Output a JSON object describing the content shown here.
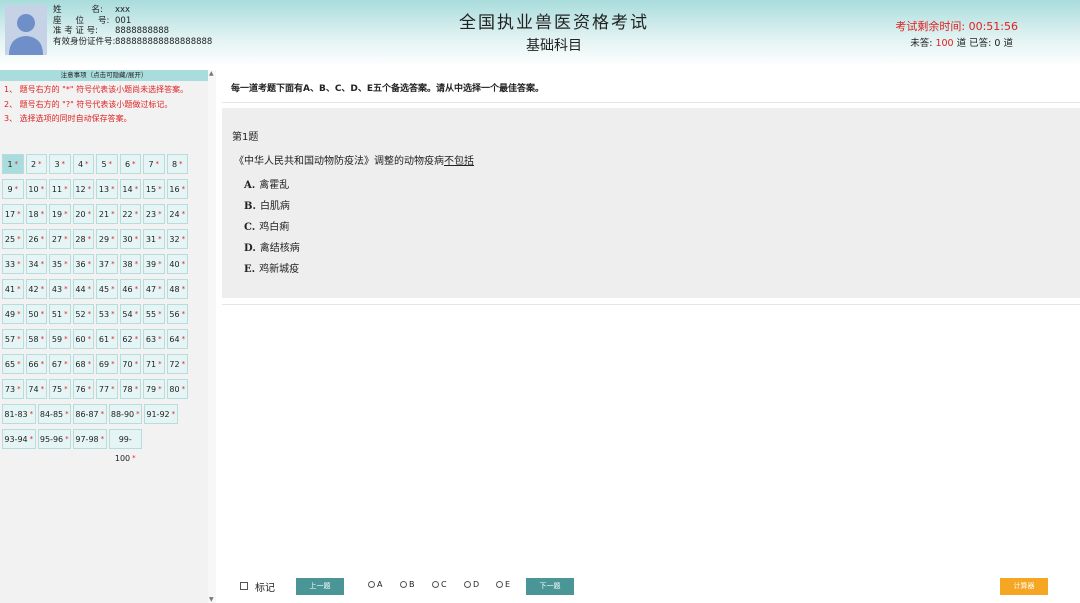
{
  "header": {
    "title": "全国执业兽医资格考试",
    "subtitle": "基础科目",
    "timer_label": "考试剩余时间: 00:51:56",
    "counts_prefix": "未答:",
    "unanswered": "100",
    "counts_mid": "道 已答:",
    "answered": "0",
    "counts_suffix": "道"
  },
  "candidate": {
    "name_label_a": "姓",
    "name_label_b": "名:",
    "name": "xxx",
    "seat_label_a": "座",
    "seat_label_b": "位",
    "seat_label_c": "号:",
    "seat": "001",
    "ticket_label": "准 考 证 号:",
    "ticket": "8888888888",
    "id_label": "有效身份证件号:",
    "id": "888888888888888888"
  },
  "notice": {
    "heading": "注意事项（点击可隐藏/展开）",
    "items": [
      "1、 题号右方的 \"*\" 符号代表该小题尚未选择答案。",
      "2、 题号右方的 \"?\" 符号代表该小题做过标记。",
      "3、 选择选项的同时自动保存答案。"
    ]
  },
  "nav": {
    "star": "*",
    "current": "1",
    "numbers": [
      "1",
      "2",
      "3",
      "4",
      "5",
      "6",
      "7",
      "8",
      "9",
      "10",
      "11",
      "12",
      "13",
      "14",
      "15",
      "16",
      "17",
      "18",
      "19",
      "20",
      "21",
      "22",
      "23",
      "24",
      "25",
      "26",
      "27",
      "28",
      "29",
      "30",
      "31",
      "32",
      "33",
      "34",
      "35",
      "36",
      "37",
      "38",
      "39",
      "40",
      "41",
      "42",
      "43",
      "44",
      "45",
      "46",
      "47",
      "48",
      "49",
      "50",
      "51",
      "52",
      "53",
      "54",
      "55",
      "56",
      "57",
      "58",
      "59",
      "60",
      "61",
      "62",
      "63",
      "64",
      "65",
      "66",
      "67",
      "68",
      "69",
      "70",
      "71",
      "72",
      "73",
      "74",
      "75",
      "76",
      "77",
      "78",
      "79",
      "80"
    ],
    "groups_row1": [
      "81-83",
      "84-85",
      "86-87",
      "88-90",
      "91-92"
    ],
    "groups_row2": [
      "93-94",
      "95-96",
      "97-98",
      "99-100"
    ]
  },
  "question": {
    "instruction": "每一道考题下面有A、B、C、D、E五个备选答案。请从中选择一个最佳答案。",
    "number_label": "第1题",
    "stem_main": "《中华人民共和国动物防疫法》调整的动物疫病",
    "stem_underlined": "不包括",
    "options": [
      {
        "key": "A.",
        "text": "禽霍乱"
      },
      {
        "key": "B.",
        "text": "白肌病"
      },
      {
        "key": "C.",
        "text": "鸡白痢"
      },
      {
        "key": "D.",
        "text": "禽结核病"
      },
      {
        "key": "E.",
        "text": "鸡新城疫"
      }
    ]
  },
  "footer": {
    "mark_label": "标记",
    "prev_label": "上一题",
    "next_label": "下一题",
    "calc_label": "计算器",
    "choices": [
      "A",
      "B",
      "C",
      "D",
      "E"
    ]
  },
  "colors": {
    "accent": "#4a9696",
    "header_teal": "#a9dcdc",
    "warning_red": "#e02020",
    "calc_orange": "#f5a623"
  }
}
